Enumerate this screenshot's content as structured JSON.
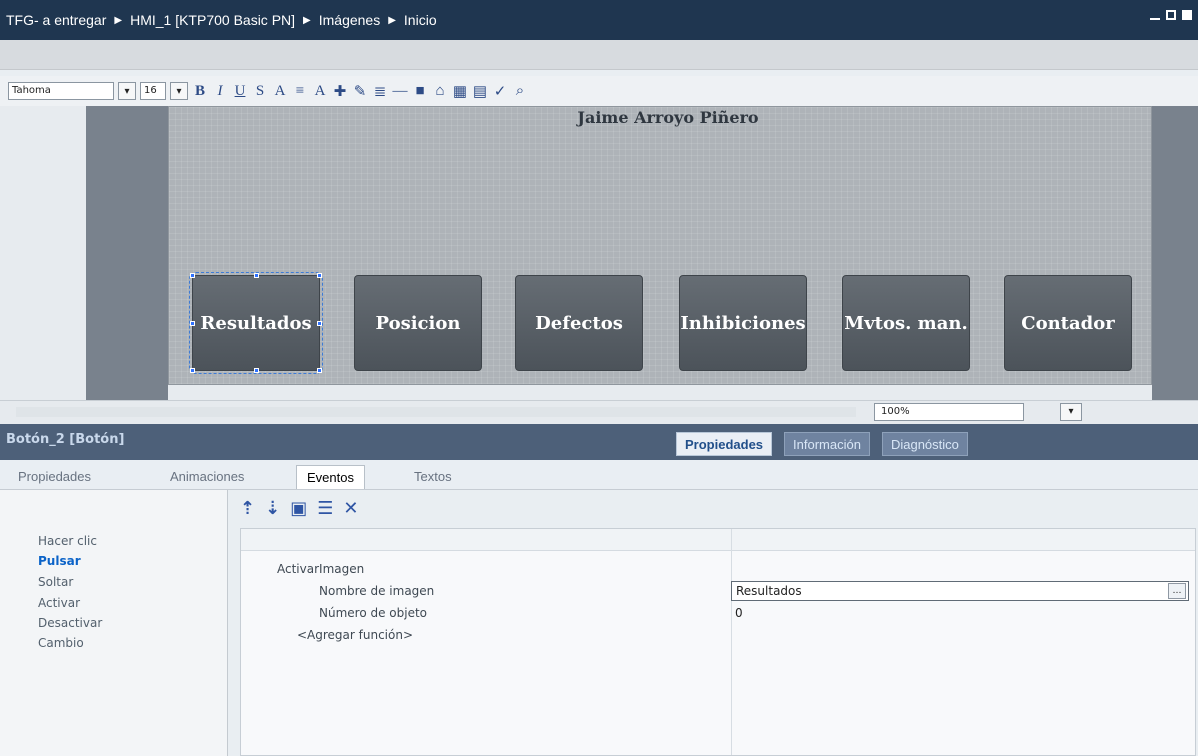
{
  "title": {
    "crumbs": [
      "TFG- a entregar",
      "HMI_1 [KTP700 Basic PN]",
      "Imágenes",
      "Inicio"
    ]
  },
  "toolbar": {
    "font_name": "Tahoma",
    "font_size": "16",
    "zoom": "100%"
  },
  "screen": {
    "heading": "Jaime Arroyo Piñero",
    "buttons": [
      {
        "label": "Resultados",
        "selected": true
      },
      {
        "label": "Posicion",
        "selected": false
      },
      {
        "label": "Defectos",
        "selected": false
      },
      {
        "label": "Inhibiciones",
        "selected": false
      },
      {
        "label": "Mvtos. man.",
        "selected": false
      },
      {
        "label": "Contador",
        "selected": false
      }
    ]
  },
  "panel": {
    "object_name": "Botón_2 [Botón]",
    "top_tabs": [
      "Propiedades",
      "Información",
      "Diagnóstico"
    ],
    "subtabs": [
      "Propiedades",
      "Animaciones",
      "Eventos",
      "Textos"
    ],
    "events": [
      "Hacer clic",
      "Pulsar",
      "Soltar",
      "Activar",
      "Desactivar",
      "Cambio"
    ],
    "active_event": "Pulsar",
    "function_name": "ActivarImagen",
    "param_image_name_label": "Nombre de imagen",
    "param_image_name_value": "Resultados",
    "param_object_number_label": "Número de objeto",
    "param_object_number_value": "0",
    "add_function": "<Agregar función>"
  }
}
